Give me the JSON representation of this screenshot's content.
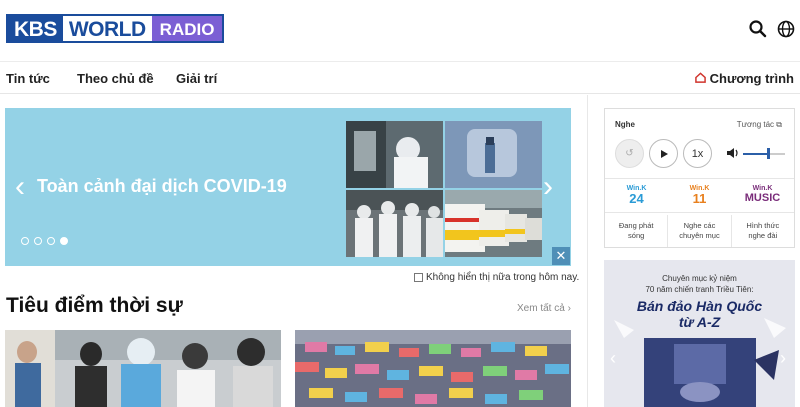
{
  "header": {
    "logo": {
      "kbs": "KBS",
      "world": "WORLD",
      "radio": "RADIO"
    },
    "icons": [
      "search-icon",
      "globe-icon"
    ]
  },
  "nav": {
    "items": [
      {
        "label": "Tin tức"
      },
      {
        "label": "Theo chủ đề"
      },
      {
        "label": "Giải trí"
      }
    ],
    "right_label": "Chương trình",
    "right_icon": "home-icon"
  },
  "banner": {
    "title": "Toàn cảnh đại dịch COVID-19",
    "slide_count": 4,
    "active_slide": 4,
    "dont_show_label": "Không hiển thị nữa trong hôm nay.",
    "bg_color": "#94d2e6"
  },
  "section": {
    "title": "Tiêu điểm thời sự",
    "see_all": "Xem tất cả"
  },
  "player": {
    "listen_label": "Nghe",
    "interact_label": "Tương tác",
    "speed_label": "1x",
    "channels": [
      {
        "name": "Win.K",
        "num": "24",
        "color": "#2a9bd6"
      },
      {
        "name": "Win.K",
        "num": "11",
        "color": "#e8801e"
      },
      {
        "name": "Win.K",
        "num": "MUSIC",
        "color": "#7a2d7a"
      }
    ],
    "links": [
      {
        "l1": "Đang phát",
        "l2": "sóng"
      },
      {
        "l1": "Nghe các",
        "l2": "chuyên mục"
      },
      {
        "l1": "Hình thức",
        "l2": "nghe đài"
      }
    ]
  },
  "promo": {
    "line1": "Chuyên mục kỷ niệm",
    "line2": "70 năm chiến tranh Triều Tiên:",
    "title": "Bán đảo Hàn Quốc",
    "subtitle": "từ A-Z"
  }
}
